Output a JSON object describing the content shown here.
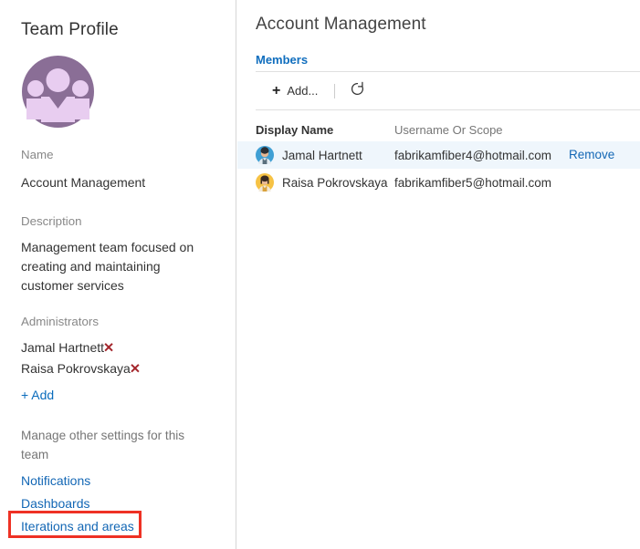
{
  "sidebar": {
    "title": "Team Profile",
    "avatar_icon": "team-group-avatar-icon",
    "avatar_bg_color": "#8a6e96",
    "avatar_fg_color": "#e8cdf0",
    "name_label": "Name",
    "name_value": "Account Management",
    "description_label": "Description",
    "description_value": "Management team focused on creating and maintaining customer services",
    "administrators_label": "Administrators",
    "administrators": [
      {
        "name": "Jamal Hartnett",
        "remove_icon": "✕"
      },
      {
        "name": "Raisa Pokrovskaya",
        "remove_icon": "✕"
      }
    ],
    "add_admin_label": "+ Add",
    "manage_note": "Manage other settings for this team",
    "settings_links": [
      {
        "label": "Notifications"
      },
      {
        "label": "Dashboards"
      },
      {
        "label": "Iterations and areas"
      }
    ],
    "annotation_color": "#ee3124",
    "remove_x_color": "#a4262c",
    "link_color": "#1367b5"
  },
  "content": {
    "title": "Account Management",
    "pivot": {
      "label": "Members",
      "color": "#106ebe"
    },
    "toolbar": {
      "add_icon": "+",
      "add_label": "Add...",
      "refresh_icon": "refresh-icon"
    },
    "table": {
      "columns": [
        "Display Name",
        "Username Or Scope"
      ],
      "rows": [
        {
          "display_name": "Jamal Hartnett",
          "username": "fabrikamfiber4@hotmail.com",
          "action_label": "Remove",
          "selected": true,
          "avatar_bg": "#3f9fd4",
          "avatar_hair": "#2d2f33",
          "avatar_skin": "#e8b893"
        },
        {
          "display_name": "Raisa Pokrovskaya",
          "username": "fabrikamfiber5@hotmail.com",
          "action_label": "",
          "selected": false,
          "avatar_bg": "#f6c244",
          "avatar_hair": "#3a2b22",
          "avatar_skin": "#e8b893"
        }
      ]
    }
  }
}
